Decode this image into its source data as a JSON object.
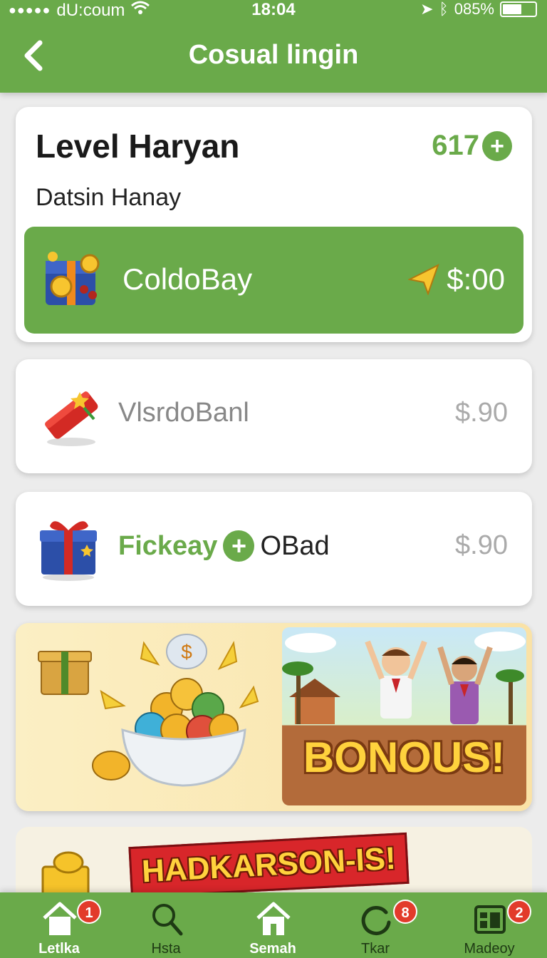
{
  "status_bar": {
    "carrier": "dU:coum",
    "time": "18:04",
    "battery": "085%"
  },
  "header": {
    "title": "Cosual lingin",
    "back_icon": "chevron-left-icon"
  },
  "level_card": {
    "title": "Level Haryan",
    "points": "617",
    "subtitle": "Datsin Hanay",
    "highlight_row": {
      "label": "ColdoBay",
      "price": "$:00",
      "icon": "treasure-box-icon"
    }
  },
  "items": [
    {
      "label": "VlsrdoBanl",
      "price": "$.90",
      "icon": "firecracker-icon"
    },
    {
      "label_green": "Fickeay",
      "label_dark": "OBad",
      "price": "$.90",
      "icon": "gift-box-icon"
    }
  ],
  "banner": {
    "bonus_text": "BONOUS!"
  },
  "banner2": {
    "text": "HADKARSON-IS!"
  },
  "bottom_nav": [
    {
      "label": "Letlka",
      "badge": "1",
      "icon": "home-icon"
    },
    {
      "label": "Hsta",
      "badge": "",
      "icon": "search-icon"
    },
    {
      "label": "Semah",
      "badge": "",
      "icon": "home-icon"
    },
    {
      "label": "Tkar",
      "badge": "8",
      "icon": "refresh-icon"
    },
    {
      "label": "Madeoy",
      "badge": "2",
      "icon": "dashboard-icon"
    }
  ],
  "colors": {
    "brand_green": "#6aaa4a",
    "badge_red": "#e23b2b",
    "bonus_gold": "#ffd23d"
  }
}
